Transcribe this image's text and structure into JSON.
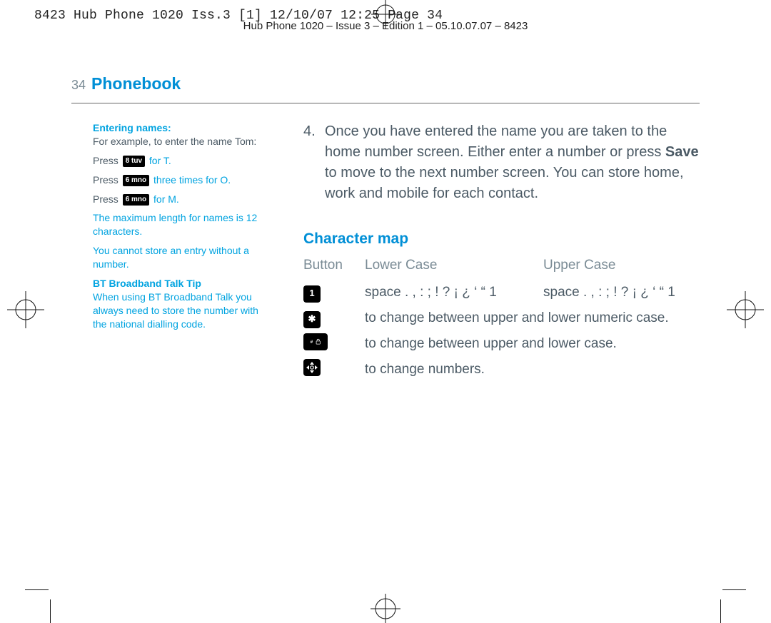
{
  "header": {
    "line1": "8423 Hub Phone 1020 Iss.3 [1]  12/10/07  12:25  Page 34",
    "line2": "Hub Phone 1020 – Issue 3 – Edition 1 – 05.10.07.07 – 8423"
  },
  "page": {
    "number": "34",
    "title": "Phonebook"
  },
  "sidebar": {
    "entering_heading": "Entering names:",
    "example_intro": "For example, to enter the name Tom:",
    "press_label": "Press ",
    "key1": "8 tuv",
    "for_t": " for T.",
    "key2": "6 mno",
    "press_three": " three times for O.",
    "key3": "6 mno",
    "for_m": " for M.",
    "max_len": "The maximum length for names is 12 characters.",
    "no_number": "You cannot store an entry  without a number.",
    "tip_heading": "BT Broadband Talk Tip",
    "tip_body": "When using BT Broadband Talk you always need to store the number with the national dialling code."
  },
  "main": {
    "step_num": "4.",
    "step_pre": "Once you have entered the name you are taken to the home number screen. Either enter a number or press ",
    "save": "Save",
    "step_post": " to move to the next number screen. You can store home, work and mobile for each contact.",
    "char_heading": "Character map",
    "col_button": "Button",
    "col_lower": "Lower Case",
    "col_upper": "Upper Case",
    "row1_btn": "1",
    "row1_lower": "space . , : ; ! ? ¡ ¿ ‘ “ 1",
    "row1_upper": "space . , : ; ! ? ¡ ¿ ‘ “ 1",
    "row2_btn": "✱",
    "row2_text": "to change between upper and lower numeric case.",
    "row3_text": "to change between upper and lower case.",
    "row4_text": "to change numbers."
  }
}
